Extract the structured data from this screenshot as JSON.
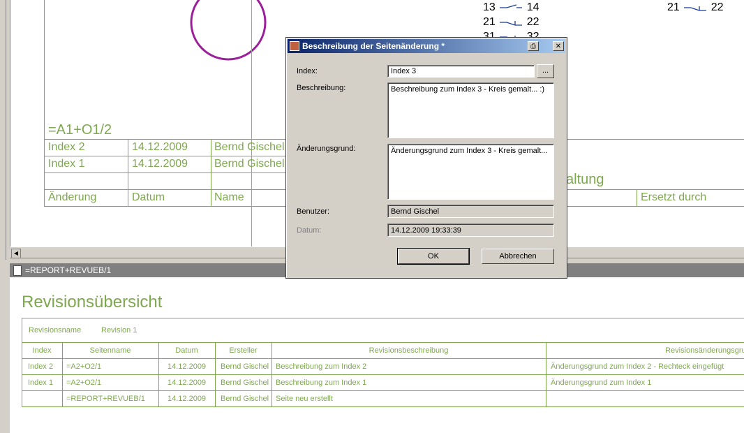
{
  "schematic": {
    "page_ref": "=A1+O1/2",
    "contacts": [
      {
        "a": "13",
        "b": "14"
      },
      {
        "a": "21",
        "b": "22"
      },
      {
        "a": "31",
        "b": "32"
      }
    ],
    "contact_right": {
      "a": "21",
      "b": "22"
    },
    "rev_rows": [
      {
        "index": "Index 2",
        "date": "14.12.2009",
        "name": "Bernd Gischel"
      },
      {
        "index": "Index 1",
        "date": "14.12.2009",
        "name": "Bernd Gischel"
      }
    ],
    "footer": {
      "change": "Änderung",
      "date": "Datum",
      "name": "Name",
      "replaced": "Ersetzt durch"
    },
    "title_fragment": "altung",
    "circle_color": "#9b1e9b",
    "green": "#7ea84e"
  },
  "doc_tab": {
    "title": "=REPORT+REVUEB/1"
  },
  "report": {
    "title": "Revisionsübersicht",
    "revision_name_label": "Revisionsname",
    "revision_name_value": "Revision 1",
    "columns": [
      "Index",
      "Seitenname",
      "Datum",
      "Ersteller",
      "Revisionsbeschreibung",
      "Revisionsänderungsgrund"
    ],
    "rows": [
      [
        "Index 2",
        "=A2+O2/1",
        "14.12.2009",
        "Bernd Gischel",
        "Beschreibung zum Index 2",
        "Änderungsgrund zum Index 2 - Rechteck eingefügt"
      ],
      [
        "Index 1",
        "=A2+O2/1",
        "14.12.2009",
        "Bernd Gischel",
        "Beschreibung zum Index 1",
        "Änderungsgrund zum Index 1"
      ],
      [
        "",
        "=REPORT+REVUEB/1",
        "14.12.2009",
        "Bernd Gischel",
        "Seite neu erstellt",
        ""
      ]
    ]
  },
  "dialog": {
    "title": "Beschreibung der Seitenänderung *",
    "index_label": "Index:",
    "index_value": "Index 3",
    "browse_label": "...",
    "desc_label": "Beschreibung:",
    "desc_value": "Beschreibung zum Index 3 - Kreis gemalt... :)",
    "reason_label": "Änderungsgrund:",
    "reason_value": "Änderungsgrund zum Index 3 - Kreis gemalt...",
    "user_label": "Benutzer:",
    "user_value": "Bernd Gischel",
    "date_label": "Datum:",
    "date_value": "14.12.2009 19:33:39",
    "ok_label": "OK",
    "cancel_label": "Abbrechen",
    "close_glyph": "✕",
    "print_glyph": "⎙"
  }
}
